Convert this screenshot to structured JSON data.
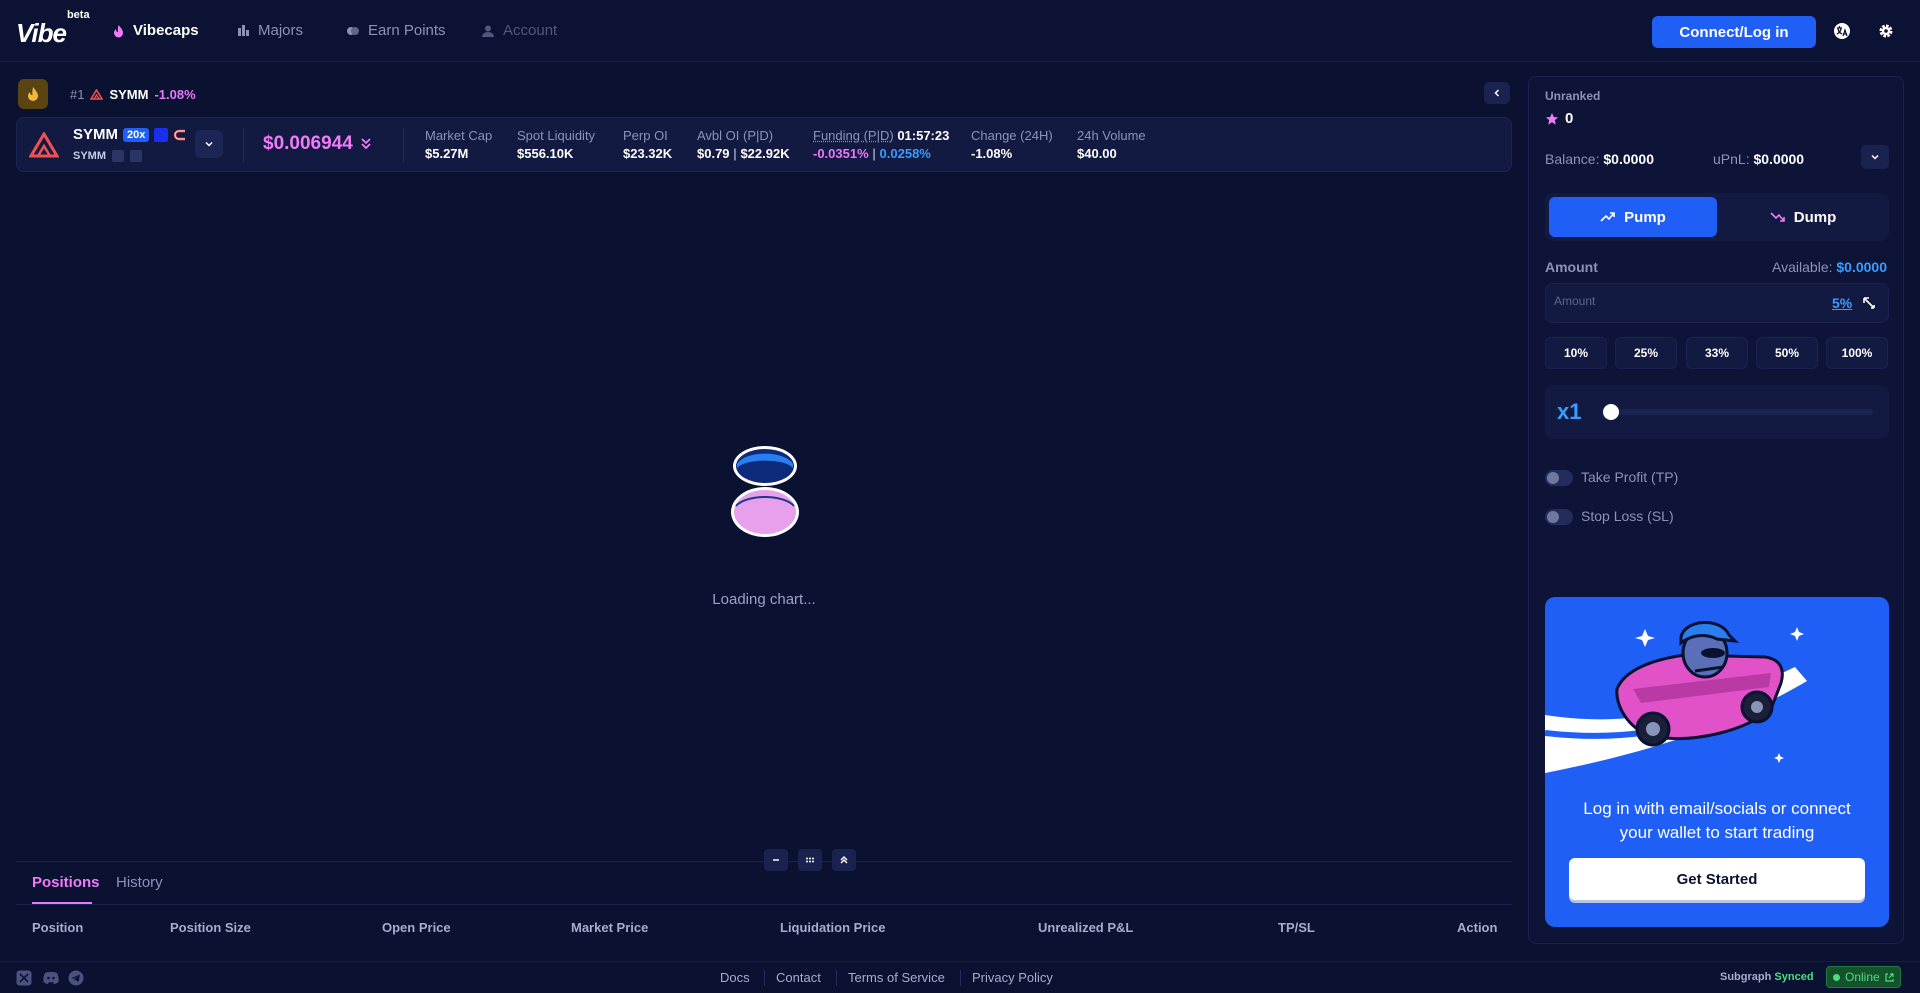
{
  "nav": {
    "logo": "Vibe",
    "logo_badge": "beta",
    "items": [
      {
        "label": "Vibecaps",
        "icon": "flame-icon",
        "active": true
      },
      {
        "label": "Majors",
        "icon": "chart-icon"
      },
      {
        "label": "Earn Points",
        "icon": "coins-icon"
      },
      {
        "label": "Account",
        "icon": "user-icon",
        "disabled": true
      }
    ],
    "connect_label": "Connect/Log in"
  },
  "breadcrumb": {
    "rank": "#1",
    "symbol": "SYMM",
    "change": "-1.08%"
  },
  "token": {
    "name": "SYMM",
    "leverage": "20x",
    "ticker": "SYMM",
    "price": "$0.006944",
    "stats": {
      "market_cap_label": "Market Cap",
      "market_cap": "$5.27M",
      "spot_liquidity_label": "Spot Liquidity",
      "spot_liquidity": "$556.10K",
      "perp_oi_label": "Perp OI",
      "perp_oi": "$23.32K",
      "avbl_oi_label": "Avbl OI (P|D)",
      "avbl_oi_p": "$0.79",
      "avbl_oi_d": "$22.92K",
      "funding_label": "Funding (P|D)",
      "funding_timer": "01:57:23",
      "funding_p": "-0.0351%",
      "funding_d": "0.0258%",
      "change_label": "Change (24H)",
      "change": "-1.08%",
      "volume_label": "24h Volume",
      "volume": "$40.00"
    }
  },
  "chart": {
    "loading_text": "Loading chart..."
  },
  "positions": {
    "tabs": [
      "Positions",
      "History"
    ],
    "columns": [
      "Position",
      "Position Size",
      "Open Price",
      "Market Price",
      "Liquidation Price",
      "Unrealized P&L",
      "TP/SL",
      "Action"
    ]
  },
  "panel": {
    "rank_label": "Unranked",
    "points": "0",
    "balance_label": "Balance:",
    "balance": "$0.0000",
    "upnl_label": "uPnL:",
    "upnl": "$0.0000",
    "pump_label": "Pump",
    "dump_label": "Dump",
    "amount_label": "Amount",
    "available_label": "Available:",
    "available": "$0.0000",
    "amount_placeholder": "Amount",
    "slippage": "5%",
    "percent_buttons": [
      "10%",
      "25%",
      "33%",
      "50%",
      "100%"
    ],
    "leverage_value": "x1",
    "leverage_level": 0,
    "take_profit_label": "Take Profit (TP)",
    "stop_loss_label": "Stop Loss (SL)",
    "promo_text": "Log in with email/socials or connect your wallet to start trading",
    "get_started_label": "Get Started"
  },
  "footer": {
    "links": [
      "Docs",
      "Contact",
      "Terms of Service",
      "Privacy Policy"
    ],
    "subgraph_label": "Subgraph",
    "subgraph_status": "Synced",
    "online_label": "Online"
  },
  "colors": {
    "background": "#0a1131",
    "accent_blue": "#1f5ff6",
    "accent_pink": "#e879f9",
    "online_green": "#4ade80"
  }
}
